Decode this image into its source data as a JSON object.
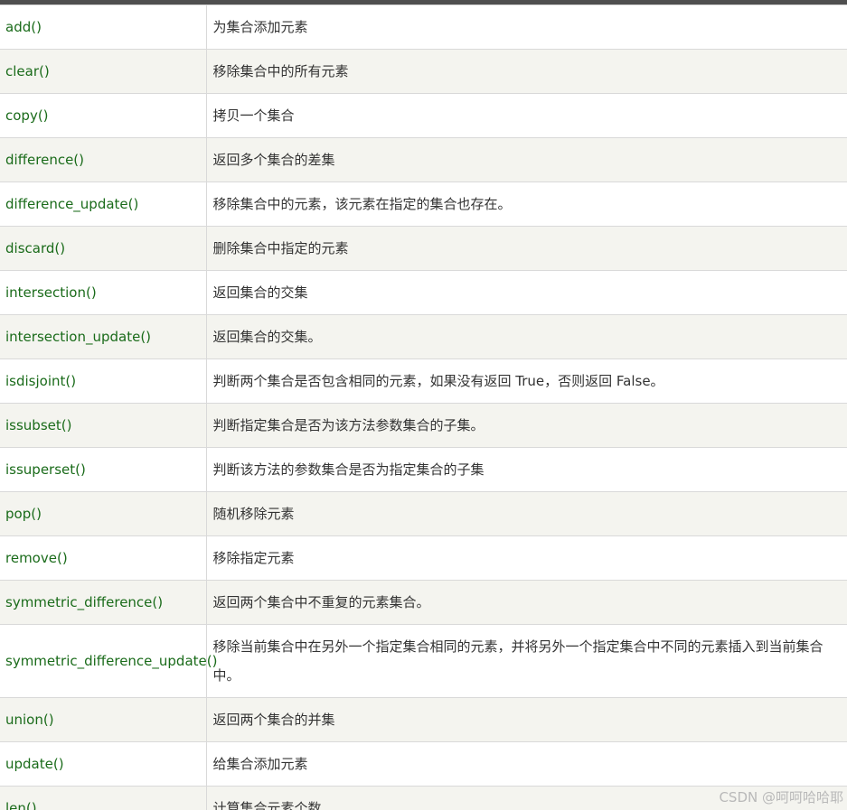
{
  "rows": [
    {
      "method": "add()",
      "desc": "为集合添加元素"
    },
    {
      "method": "clear()",
      "desc": "移除集合中的所有元素"
    },
    {
      "method": "copy()",
      "desc": "拷贝一个集合"
    },
    {
      "method": "difference()",
      "desc": "返回多个集合的差集"
    },
    {
      "method": "difference_update()",
      "desc": "移除集合中的元素，该元素在指定的集合也存在。"
    },
    {
      "method": "discard()",
      "desc": "删除集合中指定的元素"
    },
    {
      "method": "intersection()",
      "desc": "返回集合的交集"
    },
    {
      "method": "intersection_update()",
      "desc": "返回集合的交集。"
    },
    {
      "method": "isdisjoint()",
      "desc": "判断两个集合是否包含相同的元素，如果没有返回 True，否则返回 False。"
    },
    {
      "method": "issubset()",
      "desc": "判断指定集合是否为该方法参数集合的子集。"
    },
    {
      "method": "issuperset()",
      "desc": "判断该方法的参数集合是否为指定集合的子集"
    },
    {
      "method": "pop()",
      "desc": "随机移除元素"
    },
    {
      "method": "remove()",
      "desc": "移除指定元素"
    },
    {
      "method": "symmetric_difference()",
      "desc": "返回两个集合中不重复的元素集合。"
    },
    {
      "method": "symmetric_difference_update()",
      "desc": "移除当前集合中在另外一个指定集合相同的元素，并将另外一个指定集合中不同的元素插入到当前集合中。"
    },
    {
      "method": "union()",
      "desc": "返回两个集合的并集"
    },
    {
      "method": "update()",
      "desc": "给集合添加元素"
    },
    {
      "method": "len()",
      "desc": "计算集合元素个数"
    }
  ],
  "watermark": "CSDN @呵呵哈哈耶",
  "colors": {
    "method_text": "#1a6b1a",
    "desc_text": "#333333",
    "row_alt_bg": "#f4f4ef",
    "row_bg": "#ffffff",
    "border": "#d9d9d9",
    "top_bar": "#4f4f4f"
  }
}
